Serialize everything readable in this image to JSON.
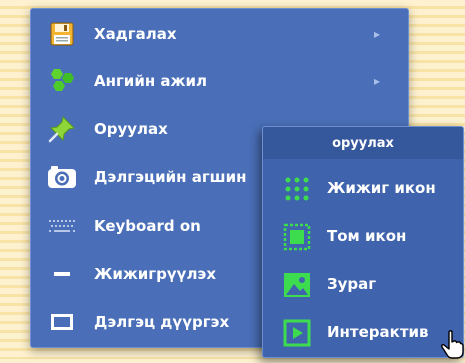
{
  "menu": {
    "items": [
      {
        "label": "Хадгалах",
        "icon": "save-icon",
        "has_submenu": true
      },
      {
        "label": "Ангийн ажил",
        "icon": "classwork-icon",
        "has_submenu": true
      },
      {
        "label": "Оруулах",
        "icon": "pin-icon",
        "has_submenu": false
      },
      {
        "label": "Дэлгэцийн агшин",
        "icon": "camera-icon",
        "has_submenu": false
      },
      {
        "label": "Keyboard on",
        "icon": "keyboard-icon",
        "has_submenu": false
      },
      {
        "label": "Жижигрүүлэх",
        "icon": "minimize-icon",
        "has_submenu": false
      },
      {
        "label": "Дэлгэц дүүргэх",
        "icon": "fullscreen-icon",
        "has_submenu": false
      }
    ],
    "arrow_glyph": "▸"
  },
  "submenu": {
    "title": "оруулах",
    "items": [
      {
        "label": "Жижиг икон",
        "icon": "small-grid-icon"
      },
      {
        "label": "Том икон",
        "icon": "large-icon"
      },
      {
        "label": "Зураг",
        "icon": "image-icon"
      },
      {
        "label": "Интерактив",
        "icon": "play-icon"
      }
    ]
  },
  "colors": {
    "menu_bg": "#4a6fb8",
    "submenu_bg": "#3f63ad",
    "accent_green": "#3ddc4f",
    "text": "#ffffff"
  }
}
